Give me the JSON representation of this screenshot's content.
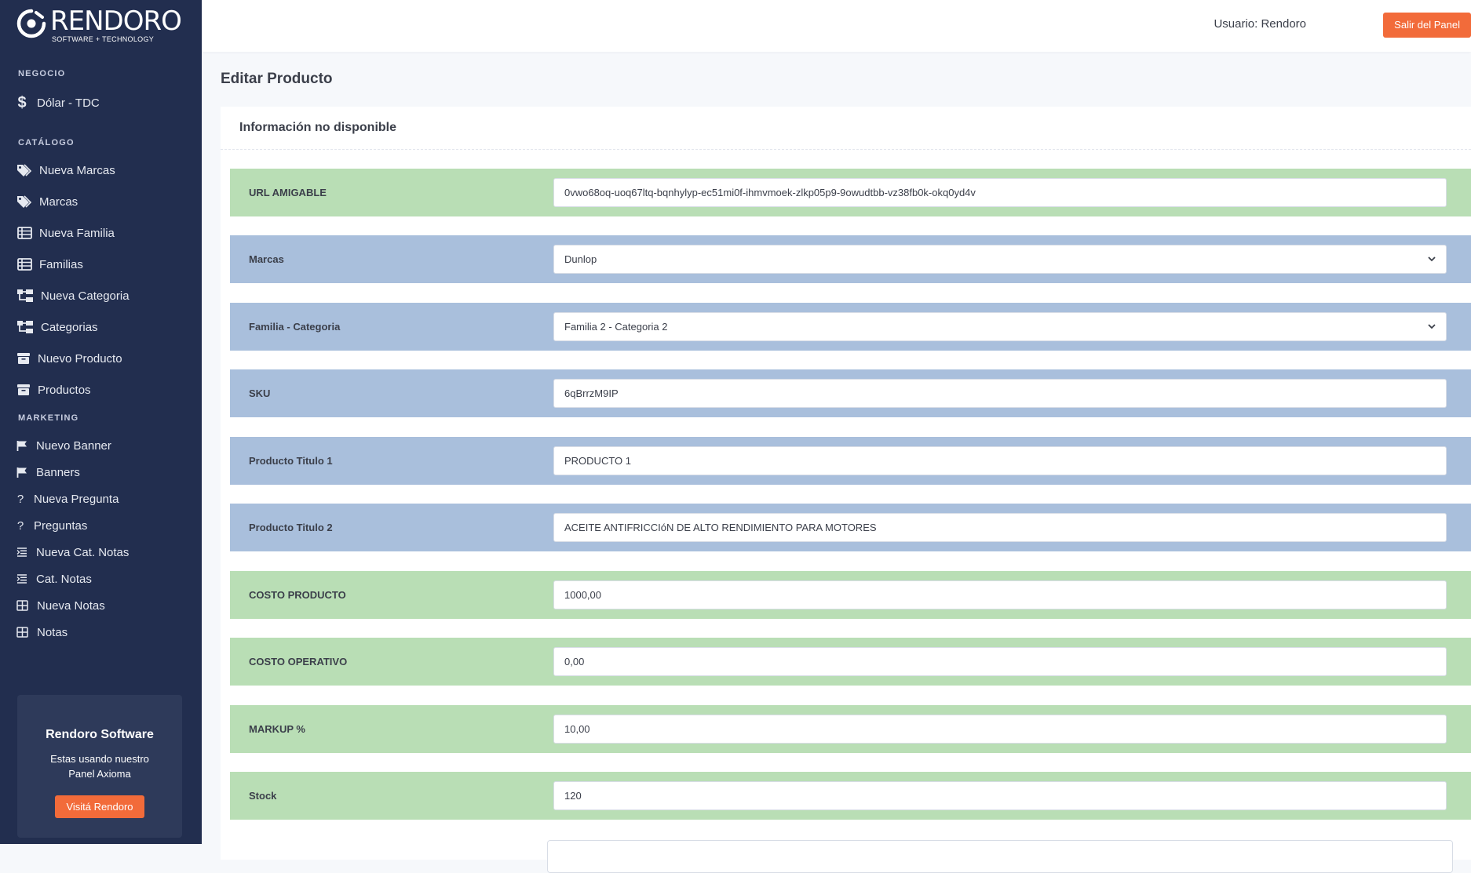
{
  "sidebar": {
    "brand": {
      "name": "RENDORO",
      "tagline": "SOFTWARE + TECHNOLOGY"
    },
    "sections": {
      "negocio": "NEGOCIO",
      "catalogo": "CATÁLOGO",
      "marketing": "MARKETING"
    },
    "items": [
      {
        "label": "Dólar - TDC",
        "icon": "dollar-icon"
      },
      {
        "label": "Nueva Marcas",
        "icon": "tags-icon"
      },
      {
        "label": "Marcas",
        "icon": "tags-icon"
      },
      {
        "label": "Nueva Familia",
        "icon": "table-list-icon"
      },
      {
        "label": "Familias",
        "icon": "table-list-icon"
      },
      {
        "label": "Nueva Categoria",
        "icon": "sitemap-icon"
      },
      {
        "label": "Categorias",
        "icon": "sitemap-icon"
      },
      {
        "label": "Nuevo Producto",
        "icon": "box-icon"
      },
      {
        "label": "Productos",
        "icon": "box-icon"
      },
      {
        "label": "Nuevo Banner",
        "icon": "flag-icon"
      },
      {
        "label": "Banners",
        "icon": "flag-icon"
      },
      {
        "label": "Nueva Pregunta",
        "icon": "question-icon"
      },
      {
        "label": "Preguntas",
        "icon": "question-icon"
      },
      {
        "label": "Nueva Cat. Notas",
        "icon": "list-indent-icon"
      },
      {
        "label": "Cat. Notas",
        "icon": "list-indent-icon"
      },
      {
        "label": "Nueva Notas",
        "icon": "grid-icon"
      },
      {
        "label": "Notas",
        "icon": "grid-icon"
      }
    ],
    "promo": {
      "title": "Rendoro Software",
      "text": "Estas usando nuestro Panel Axioma",
      "button": "Visitá Rendoro"
    }
  },
  "topbar": {
    "user": "Usuario: Rendoro",
    "logout": "Salir del Panel"
  },
  "page": {
    "title": "Editar Producto",
    "card_header": "Información no disponible"
  },
  "form": {
    "fields": [
      {
        "label": "URL AMIGABLE",
        "value": "0vwo68oq-uoq67ltq-bqnhylyp-ec51mi0f-ihmvmoek-zlkp05p9-9owudtbb-vz38fb0k-okq0yd4v",
        "kind": "text",
        "color": "#b9deb5"
      },
      {
        "label": "Marcas",
        "value": "Dunlop",
        "kind": "select",
        "color": "#a9bfdc"
      },
      {
        "label": "Familia - Categoria",
        "value": "Familia 2 - Categoria 2",
        "kind": "select",
        "color": "#a9bfdc"
      },
      {
        "label": "SKU",
        "value": "6qBrrzM9IP",
        "kind": "text",
        "color": "#a9bfdc"
      },
      {
        "label": "Producto Titulo 1",
        "value": "PRODUCTO 1",
        "kind": "text",
        "color": "#a9bfdc"
      },
      {
        "label": "Producto Titulo 2",
        "value": "ACEITE ANTIFRICCIóN DE ALTO RENDIMIENTO PARA MOTORES",
        "kind": "text",
        "color": "#a9bfdc"
      },
      {
        "label": "COSTO PRODUCTO",
        "value": "1000,00",
        "kind": "text",
        "color": "#b9deb5"
      },
      {
        "label": "COSTO OPERATIVO",
        "value": "0,00",
        "kind": "text",
        "color": "#b9deb5"
      },
      {
        "label": "MARKUP %",
        "value": "10,00",
        "kind": "text",
        "color": "#b9deb5"
      },
      {
        "label": "Stock",
        "value": "120",
        "kind": "text",
        "color": "#b9deb5"
      }
    ]
  },
  "colors": {
    "sidebar_bg": "#222e4f",
    "accent": "#f26b3a",
    "row_green": "#b9deb5",
    "row_blue": "#a9bfdc"
  }
}
